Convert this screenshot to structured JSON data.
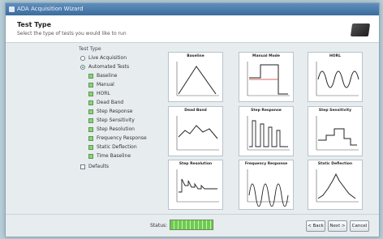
{
  "window": {
    "title": "ADA Acquisition Wizard"
  },
  "header": {
    "title": "Test Type",
    "subtitle": "Select the type of tests you would like to run"
  },
  "options": {
    "group_label": "Test Type",
    "live_acquisition": {
      "label": "Live Acquisition",
      "selected": false
    },
    "automated_tests": {
      "label": "Automated Tests",
      "selected": true
    },
    "tests": [
      {
        "label": "Baseline",
        "checked": true
      },
      {
        "label": "Manual",
        "checked": true
      },
      {
        "label": "HORL",
        "checked": true
      },
      {
        "label": "Dead Band",
        "checked": true
      },
      {
        "label": "Step Response",
        "checked": true
      },
      {
        "label": "Step Sensitivity",
        "checked": true
      },
      {
        "label": "Step Resolution",
        "checked": true
      },
      {
        "label": "Frequency Response",
        "checked": true
      },
      {
        "label": "Static Deflection",
        "checked": true
      },
      {
        "label": "Time Baseline",
        "checked": true
      }
    ],
    "defaults": {
      "label": "Defaults",
      "checked": false
    }
  },
  "thumbnails": [
    {
      "title": "Baseline"
    },
    {
      "title": "Manual Mode"
    },
    {
      "title": "HORL"
    },
    {
      "title": "Dead Band"
    },
    {
      "title": "Step Response"
    },
    {
      "title": "Step Sensitivity"
    },
    {
      "title": "Step Resolution"
    },
    {
      "title": "Frequency Response"
    },
    {
      "title": "Static Deflection"
    }
  ],
  "footer": {
    "status_label": "Status:",
    "progress_fraction": 1.0,
    "back_label": "< Back",
    "next_label": "Next >",
    "cancel_label": "Cancel"
  },
  "colors": {
    "titlebar": "#3c6c9c",
    "progress": "#6fcb4f",
    "check_on": "#8fcf7e"
  },
  "icons": {
    "title_icon": "app-icon",
    "header_logo": "device-icon"
  }
}
